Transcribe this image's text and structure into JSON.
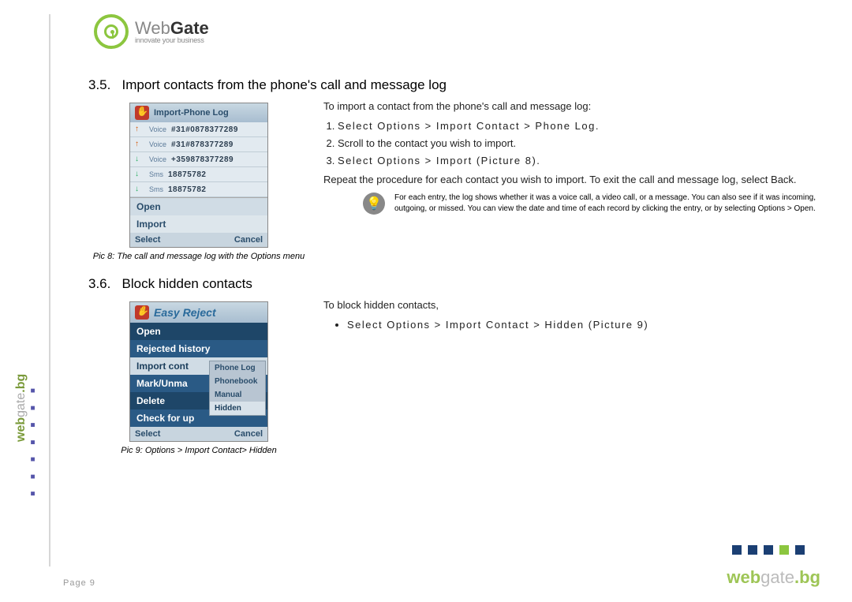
{
  "logo": {
    "word1": "Web",
    "word2": "Gate",
    "tagline": "innovate your business"
  },
  "section35": {
    "number": "3.5.",
    "title": "Import contacts from the phone's call and message log",
    "intro": "To import a contact from the phone's call and message log:",
    "steps": [
      "Select Options > Import Contact > Phone Log.",
      "Scroll to the contact you wish to import.",
      "Select Options > Import (Picture 8)."
    ],
    "repeat": "Repeat the procedure for each contact you wish to import. To exit the call and message log, select Back.",
    "tip": "For each entry, the log shows whether it was a voice call, a video call, or a message. You can also see if it was incoming, outgoing, or missed. You can view the date and time of each record by clicking the entry, or by selecting Options > Open.",
    "phone": {
      "title": "Import-Phone Log",
      "rows": [
        {
          "dir": "up",
          "type": "Voice",
          "num": "#31#0878377289"
        },
        {
          "dir": "up",
          "type": "Voice",
          "num": "#31#878377289"
        },
        {
          "dir": "down",
          "type": "Voice",
          "num": "+359878377289"
        },
        {
          "dir": "down",
          "type": "Sms",
          "num": "18875782"
        },
        {
          "dir": "down",
          "type": "Sms",
          "num": "18875782"
        }
      ],
      "menu": [
        "Open",
        "Import"
      ],
      "softkeys": {
        "left": "Select",
        "right": "Cancel"
      }
    },
    "caption": "Pic 8: The call and message log with the Options menu"
  },
  "section36": {
    "number": "3.6.",
    "title": "Block hidden contacts",
    "intro": "To block hidden contacts,",
    "bullet": "Select Options > Import Contact > Hidden (Picture 9)",
    "phone": {
      "title": "Easy Reject",
      "menu": [
        "Open",
        "Rejected history",
        "Import cont",
        "Mark/Unma",
        "Delete",
        "Check for up"
      ],
      "submenu": [
        "Phone Log",
        "Phonebook",
        "Manual",
        "Hidden"
      ],
      "softkeys": {
        "left": "Select",
        "right": "Cancel"
      }
    },
    "caption": "Pic 9: Options > Import Contact> Hidden"
  },
  "footer": {
    "page": "Page 9",
    "brand_web": "web",
    "brand_gate": "gate",
    "brand_bg": ".bg"
  }
}
